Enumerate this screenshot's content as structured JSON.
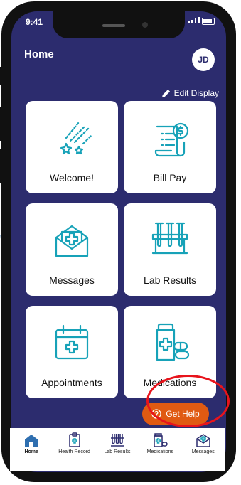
{
  "status_bar": {
    "time": "9:41"
  },
  "header": {
    "title": "Home",
    "avatar_initials": "JD",
    "edit_label": "Edit Display"
  },
  "tiles": [
    {
      "label": "Welcome!",
      "icon": "stars-icon"
    },
    {
      "label": "Bill Pay",
      "icon": "receipt-dollar-icon"
    },
    {
      "label": "Messages",
      "icon": "envelope-medical-icon"
    },
    {
      "label": "Lab Results",
      "icon": "test-tubes-icon"
    },
    {
      "label": "Appointments",
      "icon": "calendar-medical-icon"
    },
    {
      "label": "Medications",
      "icon": "pill-bottle-icon"
    }
  ],
  "help_button": {
    "label": "Get Help"
  },
  "bottom_nav": [
    {
      "label": "Home",
      "icon": "home-icon",
      "active": true
    },
    {
      "label": "Health Record",
      "icon": "clipboard-icon"
    },
    {
      "label": "Lab Results",
      "icon": "test-tubes-icon"
    },
    {
      "label": "Medications",
      "icon": "pill-bottle-icon"
    },
    {
      "label": "Messages",
      "icon": "envelope-medical-icon"
    }
  ],
  "colors": {
    "primary": "#2c2c6e",
    "accent": "#17a2b8",
    "help": "#e05a12",
    "highlight": "#e8141c"
  }
}
